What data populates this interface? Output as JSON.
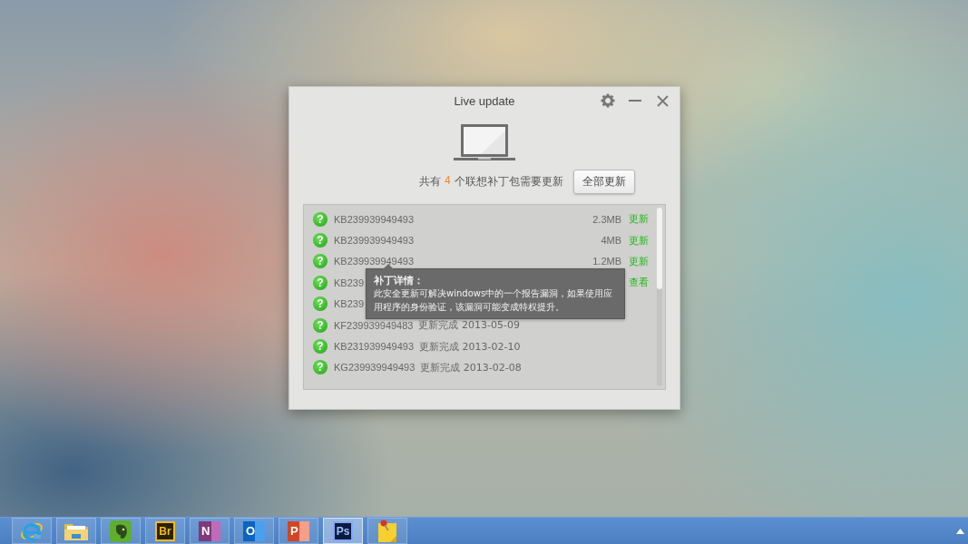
{
  "window": {
    "title": "Live update"
  },
  "summary": {
    "before": "共有",
    "count": "4",
    "after": "个联想补丁包需要更新"
  },
  "update_all_button": "全部更新",
  "patches": [
    {
      "kind": "pending",
      "status_icon": "?",
      "name": "KB239939949493",
      "size": "2.3MB",
      "action": "更新"
    },
    {
      "kind": "pending",
      "status_icon": "?",
      "name": "KB239939949493",
      "size": "4MB",
      "action": "更新"
    },
    {
      "kind": "pending",
      "status_icon": "?",
      "name": "KB239939949493",
      "size": "1.2MB",
      "action": "更新"
    },
    {
      "kind": "pending",
      "status_icon": "?",
      "name": "KB239",
      "action": "查看"
    },
    {
      "kind": "done",
      "status_icon": "?",
      "name": "KB239"
    },
    {
      "kind": "done",
      "status_icon": "?",
      "name": "KF239939949483",
      "status": "更新完成 2013-05-09"
    },
    {
      "kind": "done",
      "status_icon": "?",
      "name": "KB231939949493",
      "status": "更新完成 2013-02-10"
    },
    {
      "kind": "done",
      "status_icon": "?",
      "name": "KG239939949493",
      "status": "更新完成 2013-02-08"
    }
  ],
  "tooltip": {
    "title": "补丁详情：",
    "text": "此安全更新可解决windows中的一个报告漏洞，如果使用应用程序的身份验证，该漏洞可能变成特权提升。"
  },
  "taskbar": [
    {
      "kind": "ie",
      "selected": false
    },
    {
      "kind": "folder",
      "selected": false
    },
    {
      "kind": "evernote",
      "selected": false
    },
    {
      "kind": "tile",
      "label": "Br",
      "color": "#2b2200",
      "selected": false
    },
    {
      "kind": "onenote",
      "label": "N",
      "selected": false
    },
    {
      "kind": "outlook",
      "label": "O",
      "selected": false
    },
    {
      "kind": "powerpoint",
      "label": "P",
      "selected": false
    },
    {
      "kind": "tile",
      "label": "Ps",
      "color": "#0d1a40",
      "selected": true
    },
    {
      "kind": "note",
      "selected": false
    }
  ]
}
